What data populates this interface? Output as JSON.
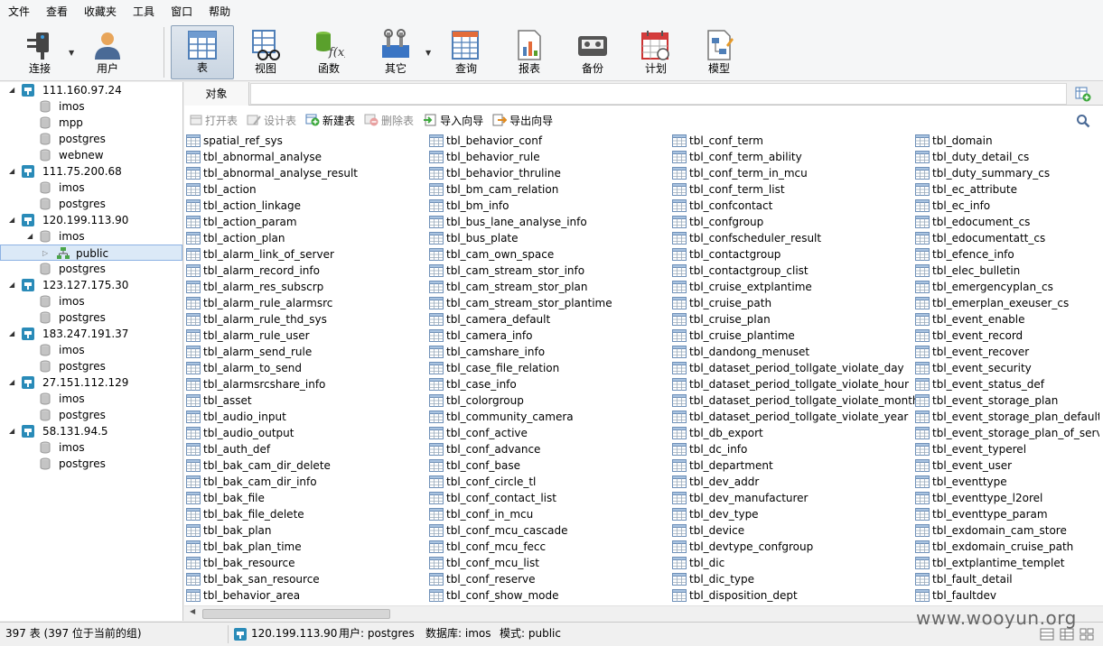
{
  "menu": [
    "文件",
    "查看",
    "收藏夹",
    "工具",
    "窗口",
    "帮助"
  ],
  "toolbar": {
    "connect": "连接",
    "user": "用户",
    "table": "表",
    "view": "视图",
    "function": "函数",
    "other": "其它",
    "query": "查询",
    "report": "报表",
    "backup": "备份",
    "schedule": "计划",
    "model": "模型"
  },
  "tree": [
    {
      "type": "server",
      "label": "111.160.97.24"
    },
    {
      "type": "db",
      "label": "imos"
    },
    {
      "type": "db",
      "label": "mpp"
    },
    {
      "type": "db",
      "label": "postgres"
    },
    {
      "type": "db",
      "label": "webnew"
    },
    {
      "type": "server",
      "label": "111.75.200.68"
    },
    {
      "type": "db",
      "label": "imos"
    },
    {
      "type": "db",
      "label": "postgres"
    },
    {
      "type": "server",
      "label": "120.199.113.90"
    },
    {
      "type": "dbopen",
      "label": "imos"
    },
    {
      "type": "schema",
      "label": "public"
    },
    {
      "type": "db",
      "label": "postgres"
    },
    {
      "type": "server",
      "label": "123.127.175.30"
    },
    {
      "type": "db",
      "label": "imos"
    },
    {
      "type": "db",
      "label": "postgres"
    },
    {
      "type": "server",
      "label": "183.247.191.37"
    },
    {
      "type": "db",
      "label": "imos"
    },
    {
      "type": "db",
      "label": "postgres"
    },
    {
      "type": "server",
      "label": "27.151.112.129"
    },
    {
      "type": "db",
      "label": "imos"
    },
    {
      "type": "db",
      "label": "postgres"
    },
    {
      "type": "server",
      "label": "58.131.94.5"
    },
    {
      "type": "db",
      "label": "imos"
    },
    {
      "type": "db",
      "label": "postgres"
    }
  ],
  "tab_label": "对象",
  "object_toolbar": {
    "open": "打开表",
    "design": "设计表",
    "new": "新建表",
    "delete": "删除表",
    "import": "导入向导",
    "export": "导出向导"
  },
  "tables": [
    [
      "spatial_ref_sys",
      "tbl_abnormal_analyse",
      "tbl_abnormal_analyse_result",
      "tbl_action",
      "tbl_action_linkage",
      "tbl_action_param",
      "tbl_action_plan",
      "tbl_alarm_link_of_server",
      "tbl_alarm_record_info",
      "tbl_alarm_res_subscrp",
      "tbl_alarm_rule_alarmsrc",
      "tbl_alarm_rule_thd_sys",
      "tbl_alarm_rule_user",
      "tbl_alarm_send_rule",
      "tbl_alarm_to_send",
      "tbl_alarmsrcshare_info",
      "tbl_asset",
      "tbl_audio_input",
      "tbl_audio_output",
      "tbl_auth_def",
      "tbl_bak_cam_dir_delete",
      "tbl_bak_cam_dir_info",
      "tbl_bak_file",
      "tbl_bak_file_delete",
      "tbl_bak_plan",
      "tbl_bak_plan_time",
      "tbl_bak_resource",
      "tbl_bak_san_resource",
      "tbl_behavior_area"
    ],
    [
      "tbl_behavior_conf",
      "tbl_behavior_rule",
      "tbl_behavior_thruline",
      "tbl_bm_cam_relation",
      "tbl_bm_info",
      "tbl_bus_lane_analyse_info",
      "tbl_bus_plate",
      "tbl_cam_own_space",
      "tbl_cam_stream_stor_info",
      "tbl_cam_stream_stor_plan",
      "tbl_cam_stream_stor_plantime",
      "tbl_camera_default",
      "tbl_camera_info",
      "tbl_camshare_info",
      "tbl_case_file_relation",
      "tbl_case_info",
      "tbl_colorgroup",
      "tbl_community_camera",
      "tbl_conf_active",
      "tbl_conf_advance",
      "tbl_conf_base",
      "tbl_conf_circle_tl",
      "tbl_conf_contact_list",
      "tbl_conf_in_mcu",
      "tbl_conf_mcu_cascade",
      "tbl_conf_mcu_fecc",
      "tbl_conf_mcu_list",
      "tbl_conf_reserve",
      "tbl_conf_show_mode"
    ],
    [
      "tbl_conf_term",
      "tbl_conf_term_ability",
      "tbl_conf_term_in_mcu",
      "tbl_conf_term_list",
      "tbl_confcontact",
      "tbl_confgroup",
      "tbl_confscheduler_result",
      "tbl_contactgroup",
      "tbl_contactgroup_clist",
      "tbl_cruise_extplantime",
      "tbl_cruise_path",
      "tbl_cruise_plan",
      "tbl_cruise_plantime",
      "tbl_dandong_menuset",
      "tbl_dataset_period_tollgate_violate_day",
      "tbl_dataset_period_tollgate_violate_hour",
      "tbl_dataset_period_tollgate_violate_month",
      "tbl_dataset_period_tollgate_violate_year",
      "tbl_db_export",
      "tbl_dc_info",
      "tbl_department",
      "tbl_dev_addr",
      "tbl_dev_manufacturer",
      "tbl_dev_type",
      "tbl_device",
      "tbl_devtype_confgroup",
      "tbl_dic",
      "tbl_dic_type",
      "tbl_disposition_dept"
    ],
    [
      "tbl_domain",
      "tbl_duty_detail_cs",
      "tbl_duty_summary_cs",
      "tbl_ec_attribute",
      "tbl_ec_info",
      "tbl_edocument_cs",
      "tbl_edocumentatt_cs",
      "tbl_efence_info",
      "tbl_elec_bulletin",
      "tbl_emergencyplan_cs",
      "tbl_emerplan_exeuser_cs",
      "tbl_event_enable",
      "tbl_event_record",
      "tbl_event_recover",
      "tbl_event_security",
      "tbl_event_status_def",
      "tbl_event_storage_plan",
      "tbl_event_storage_plan_default",
      "tbl_event_storage_plan_of_server",
      "tbl_event_typerel",
      "tbl_event_user",
      "tbl_eventtype",
      "tbl_eventtype_l2orel",
      "tbl_eventtype_param",
      "tbl_exdomain_cam_store",
      "tbl_exdomain_cruise_path",
      "tbl_extplantime_templet",
      "tbl_fault_detail",
      "tbl_faultdev"
    ]
  ],
  "status": {
    "count": "397 表 (397 位于当前的组)",
    "server": "120.199.113.90",
    "user": "用户: postgres",
    "database": "数据库: imos",
    "schema": "模式: public"
  },
  "watermark": "www.wooyun.org"
}
